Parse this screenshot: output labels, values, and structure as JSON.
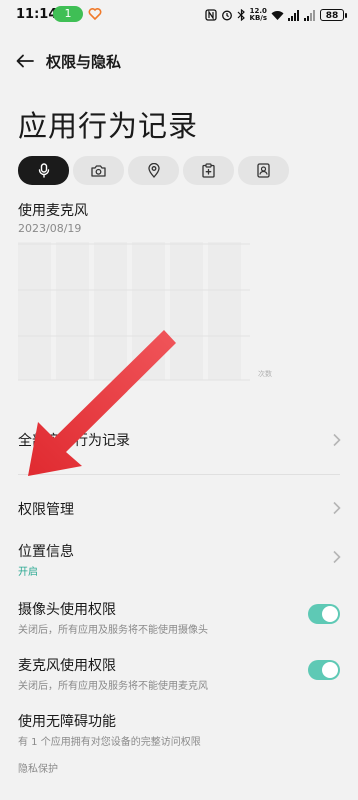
{
  "status_bar": {
    "time": "11:14",
    "notification_count": "1",
    "speed_value": "12.0",
    "speed_unit": "KB/s",
    "battery": "88"
  },
  "header": {
    "back_icon": "arrow-left-icon",
    "title": "权限与隐私"
  },
  "page_title": "应用行为记录",
  "tabs": [
    {
      "icon": "microphone-icon",
      "active": true
    },
    {
      "icon": "camera-icon",
      "active": false
    },
    {
      "icon": "location-pin-icon",
      "active": false
    },
    {
      "icon": "clipboard-icon",
      "active": false
    },
    {
      "icon": "contact-card-icon",
      "active": false
    }
  ],
  "usage": {
    "title": "使用麦克风",
    "date": "2023/08/19"
  },
  "chart_data": {
    "type": "bar",
    "unit_label": "次数",
    "series": []
  },
  "list": {
    "all_records": "全部应用行为记录",
    "permission_manage": "权限管理",
    "location": {
      "title": "位置信息",
      "status": "开启"
    },
    "camera_permission": {
      "title": "摄像头使用权限",
      "desc": "关闭后，所有应用及服务将不能使用摄像头",
      "enabled": true
    },
    "mic_permission": {
      "title": "麦克风使用权限",
      "desc": "关闭后，所有应用及服务将不能使用麦克风",
      "enabled": true
    },
    "accessibility": {
      "title": "使用无障碍功能",
      "desc": "有 1 个应用拥有对您设备的完整访问权限"
    }
  },
  "footer": {
    "section_label": "隐私保护"
  },
  "colors": {
    "accent": "#2aa892",
    "toggle_on": "#5ec9b5",
    "annotation_arrow": "#e8383d"
  }
}
